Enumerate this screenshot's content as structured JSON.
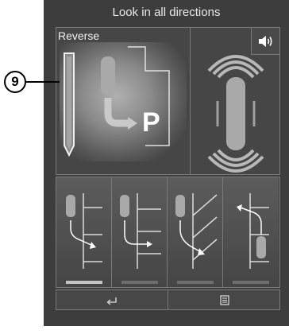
{
  "screen": {
    "title": "Look in all directions"
  },
  "view": {
    "mode_label": "Reverse",
    "parking_letter": "P"
  },
  "icons": {
    "sound": "speaker-icon",
    "back": "return-arrow-icon",
    "menu": "list-menu-icon"
  },
  "maneuvers": [
    {
      "name": "parallel-parking",
      "active": true
    },
    {
      "name": "perpendicular-parking",
      "active": false
    },
    {
      "name": "angled-parking",
      "active": false
    },
    {
      "name": "exit-parallel-parking",
      "active": false
    }
  ],
  "callout": {
    "number": "9"
  },
  "colors": {
    "screen_bg": "#3d3d3d",
    "accent_grey": "#c4c4c4"
  }
}
